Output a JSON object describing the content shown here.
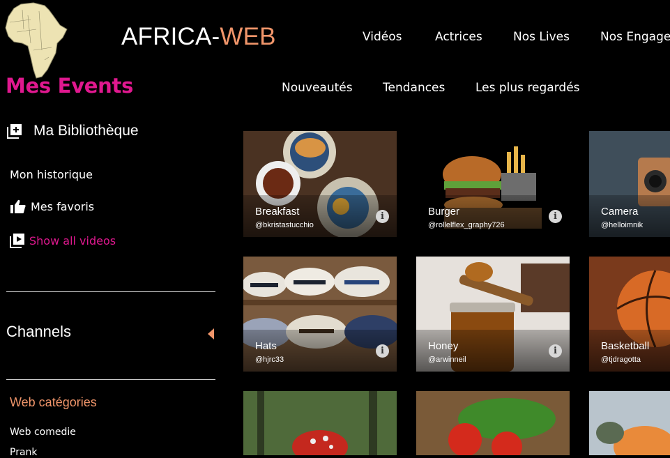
{
  "header": {
    "brand_part1": "AFRICA-",
    "brand_part2": "WEB",
    "events_title": "Mes Events",
    "top_nav": [
      "Vidéos",
      "Actrices",
      "Nos Lives",
      "Nos Engagements"
    ],
    "sub_nav": [
      "Nouveautés",
      "Tendances",
      "Les plus regardés"
    ]
  },
  "sidebar": {
    "library": "Ma Bibliothèque",
    "history": "Mon historique",
    "favorites": "Mes favoris",
    "show_all": "Show all videos",
    "channels": "Channels",
    "web_categories": "Web catégories",
    "categories": [
      "Web comedie",
      "Prank"
    ]
  },
  "colors": {
    "accent_pink": "#e0188f",
    "accent_orange": "#f0956a",
    "background": "#000000"
  },
  "cards": [
    {
      "title": "Breakfast",
      "author": "@bkristastucchio",
      "icon": "info-icon"
    },
    {
      "title": "Burger",
      "author": "@rollelflex_graphy726",
      "icon": "info-icon"
    },
    {
      "title": "Camera",
      "author": "@helloimnik",
      "icon": "info-icon"
    },
    {
      "title": "Hats",
      "author": "@hjrc33",
      "icon": "info-icon"
    },
    {
      "title": "Honey",
      "author": "@arwinneil",
      "icon": "info-icon"
    },
    {
      "title": "Basketball",
      "author": "@tjdragotta",
      "icon": "info-icon"
    },
    {
      "title": "",
      "author": "",
      "icon": ""
    },
    {
      "title": "",
      "author": "",
      "icon": ""
    },
    {
      "title": "",
      "author": "",
      "icon": ""
    }
  ]
}
